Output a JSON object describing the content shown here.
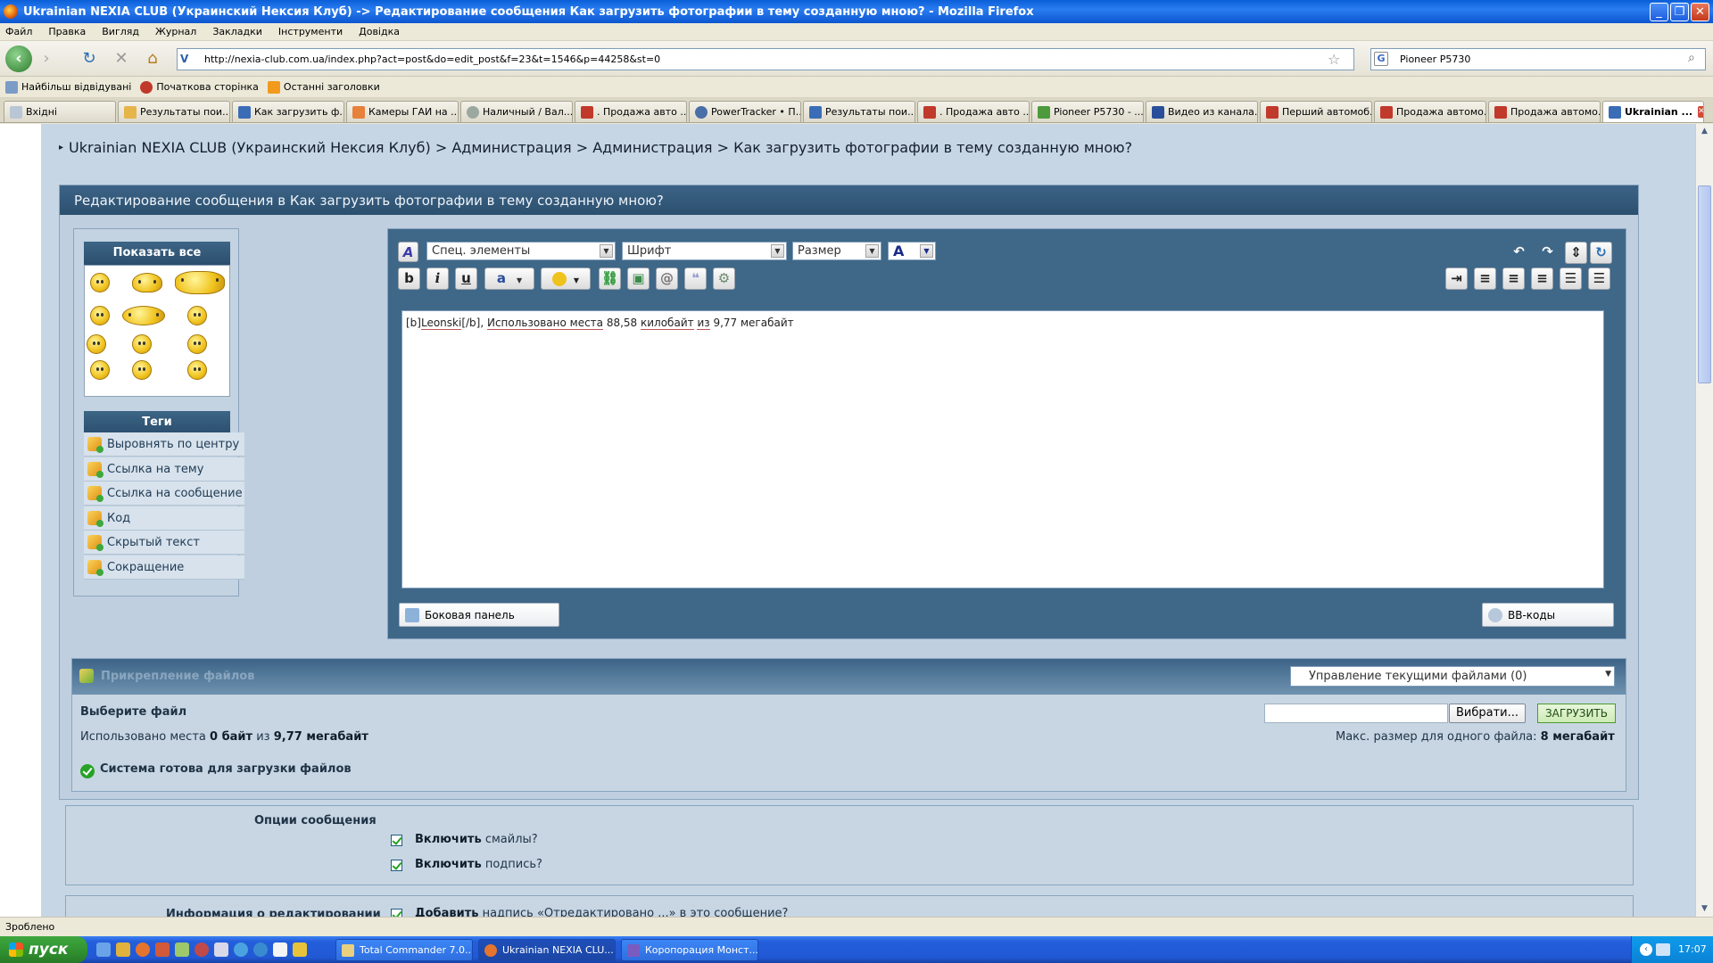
{
  "window": {
    "title": "Ukrainian NEXIA CLUB (Украинский Нексия Клуб) -> Редактирование сообщения Как загрузить фотографии в тему созданную мною? - Mozilla Firefox"
  },
  "menu": [
    "Файл",
    "Правка",
    "Вигляд",
    "Журнал",
    "Закладки",
    "Інструменти",
    "Довідка"
  ],
  "nav": {
    "url": "http://nexia-club.com.ua/index.php?act=post&do=edit_post&f=23&t=1546&p=44258&st=0",
    "search": "Pioneer P5730"
  },
  "bookmarks": [
    "Найбільш відвідувані",
    "Початкова сторінка",
    "Останні заголовки"
  ],
  "tabs": [
    "Вхідні",
    "Результаты пои...",
    "Как загрузить ф...",
    "Камеры ГАИ на ...",
    "Наличный / Вал...",
    ". Продажа авто ...",
    "PowerTracker • П...",
    "Результаты пои...",
    ". Продажа авто ...",
    "Pioneer P5730 - ...",
    "Видео из канала...",
    "Перший автомоб...",
    "Продажа автомо...",
    "Продажа автомо...",
    "Ukrainian ..."
  ],
  "breadcrumb": "Ukrainian NEXIA CLUB (Украинский Нексия Клуб) > Администрация > Администрация > Как загрузить фотографии в тему созданную мною?",
  "panel": {
    "title": "Редактирование сообщения в Как загрузить фотографии в тему созданную мною?"
  },
  "sidebar": {
    "show_all": "Показать все",
    "tags_title": "Теги",
    "tags": [
      "Выровнять по центру",
      "Ссылка на тему",
      "Ссылка на сообщение",
      "Код",
      "Скрытый текст",
      "Сокращение"
    ]
  },
  "editor": {
    "special": "Спец. элементы",
    "font": "Шрифт",
    "size": "Размер",
    "text_before": "[b]",
    "text_link": "Leonski",
    "text_mid": "[/b], ",
    "t1": "Использовано места",
    "t2": " 88,58 ",
    "t3": "килобайт",
    "t4": " ",
    "t5": "из",
    "t6": " 9,77 мегабайт",
    "sidebar_btn": "Боковая панель",
    "bbcode_btn": "BB-коды",
    "bold": "b",
    "italic": "i",
    "underline": "u"
  },
  "attach": {
    "title": "Прикрепление файлов",
    "manage": "Управление текущими файлами (0)",
    "choose": "Выберите файл",
    "used_prefix": "Использовано места",
    "used_value": "0 байт",
    "used_of": "из",
    "used_max": "9,77 мегабайт",
    "browse": "Вибрати...",
    "upload": "ЗАГРУЗИТЬ",
    "max_label": "Макс. размер для одного файла:",
    "max_value": "8 мегабайт",
    "ready": "Система готова для загрузки файлов"
  },
  "options": {
    "title": "Опции сообщения",
    "smiles_bold": "Включить",
    "smiles_rest": "смайлы?",
    "sign_bold": "Включить",
    "sign_rest": "подпись?",
    "edit_label": "Информация о редактировании",
    "edit_bold": "Добавить",
    "edit_rest": "надпись «Отредактировано ...» в это сообщение?"
  },
  "status": "Зроблено",
  "taskbar": {
    "start": "пуск",
    "tasks": [
      "Total Commander 7.0...",
      "Ukrainian NEXIA CLU...",
      "Коропорация Монст..."
    ],
    "clock": "17:07"
  }
}
